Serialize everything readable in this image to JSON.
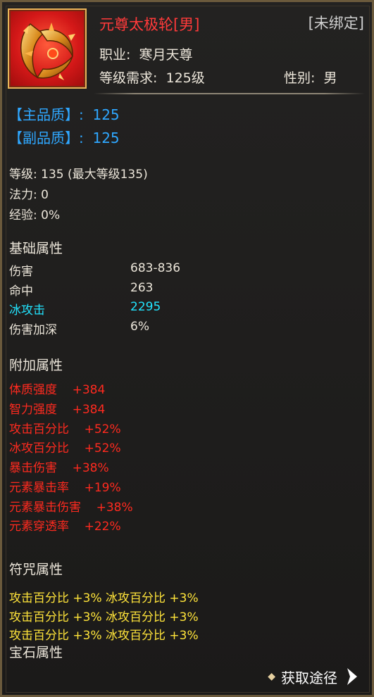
{
  "item": {
    "name": "元尊太极轮[男]",
    "bind_status": "[未绑定]",
    "class_label": "职业:",
    "class_value": "寒月天尊",
    "level_req_label": "等级需求:",
    "level_req_value": "125级",
    "gender_label": "性别:",
    "gender_value": "男"
  },
  "quality": {
    "main_label": "【主品质】:",
    "main_value": "125",
    "sub_label": "【副品质】:",
    "sub_value": "125"
  },
  "info": {
    "level": "等级: 135 (最大等级135)",
    "mana": "法力: 0",
    "exp": "经验: 0%"
  },
  "base_attrs": {
    "title": "基础属性",
    "rows": [
      {
        "name": "伤害",
        "value": "683-836"
      },
      {
        "name": "命中",
        "value": "263"
      },
      {
        "name": "冰攻击",
        "value": "2295"
      },
      {
        "name": "伤害加深",
        "value": "6%"
      }
    ]
  },
  "extra_attrs": {
    "title": "附加属性",
    "rows": [
      "体质强度    +384",
      "智力强度    +384",
      "攻击百分比    +52%",
      "冰攻百分比    +52%",
      "暴击伤害    +38%",
      "元素暴击率    +19%",
      "元素暴击伤害    +38%",
      "元素穿透率    +22%"
    ]
  },
  "rune_attrs": {
    "title": "符咒属性",
    "rows": [
      "攻击百分比 +3% 冰攻百分比 +3%",
      "攻击百分比 +3% 冰攻百分比 +3%",
      "攻击百分比 +3% 冰攻百分比 +3%"
    ]
  },
  "gem_attrs": {
    "title": "宝石属性"
  },
  "footer": {
    "obtain_label": "获取途径"
  },
  "colors": {
    "name_red": "#ff3a3a",
    "quality_blue": "#2fa7ff",
    "cyan": "#22e4ff",
    "extra_red": "#ff2a1f",
    "rune_yellow": "#ffe43a",
    "frame_gold": "#6b5a3c"
  },
  "icons": [
    "weapon-ring-icon",
    "diamond-bullet-icon",
    "chevron-right-icon"
  ]
}
